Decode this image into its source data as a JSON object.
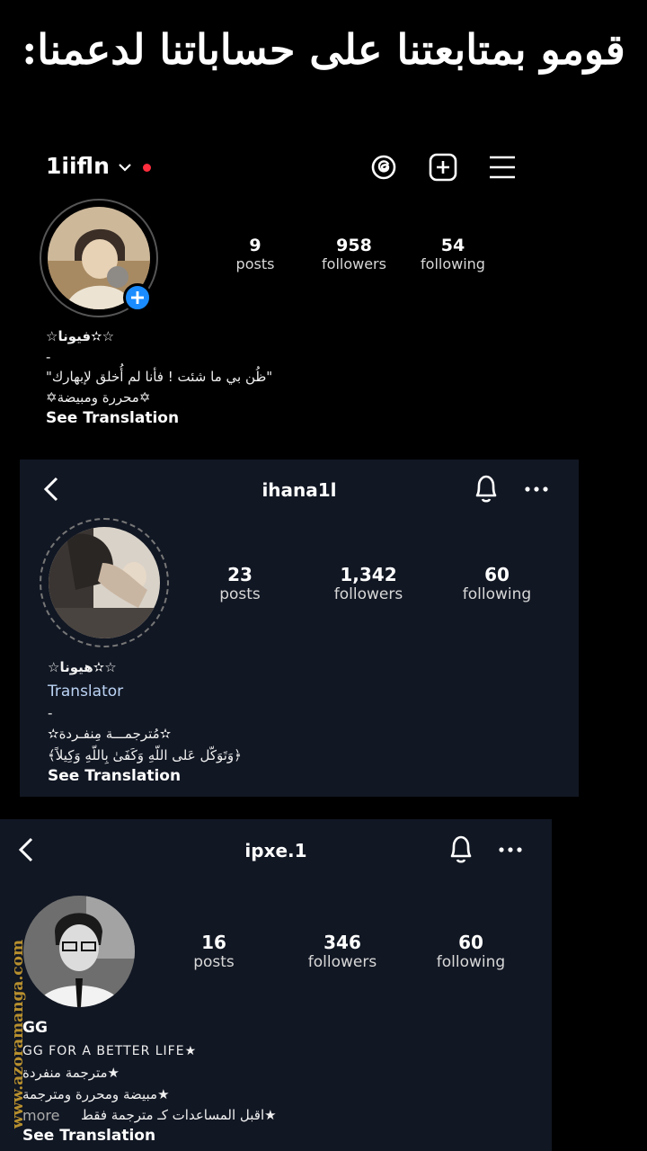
{
  "banner": {
    "text": "قومو بمتابعتنا على حساباتنا لدعمنا:"
  },
  "watermark": {
    "text": "www.azoramanga.com"
  },
  "profile1": {
    "username": "1iifln",
    "stats": [
      {
        "value": "9",
        "label": "posts"
      },
      {
        "value": "958",
        "label": "followers"
      },
      {
        "value": "54",
        "label": "following"
      }
    ],
    "name": "☆✫فيونا☆",
    "bio": [
      "-",
      "\"ظُن بي ما شئت ! فأنا لم أُخلق لإبهارك\"",
      "✡محررة ومبيضة✡"
    ],
    "see_translation": "See Translation",
    "colors": {
      "notification_dot": "#ff2d3d",
      "add_badge": "#1a8cff"
    }
  },
  "profile2": {
    "username": "ihana1l",
    "stats": [
      {
        "value": "23",
        "label": "posts"
      },
      {
        "value": "1,342",
        "label": "followers"
      },
      {
        "value": "60",
        "label": "following"
      }
    ],
    "name": "☆✫هيونا☆",
    "category": "Translator",
    "bio": [
      "-",
      "✫مُترجمـــة مِنفـردة✫",
      "﴿وَتَوَكّل عَلى اللّهِ وَكَفَىٰ بِاللّهِ وَكِيلاً﴾"
    ],
    "see_translation": "See Translation",
    "colors": {
      "category": "#bcd4f5"
    }
  },
  "profile3": {
    "username": "ipxe.1",
    "stats": [
      {
        "value": "16",
        "label": "posts"
      },
      {
        "value": "346",
        "label": "followers"
      },
      {
        "value": "60",
        "label": "following"
      }
    ],
    "name": "GG",
    "bio": [
      "GG FOR A BETTER LIFE★",
      "★مترجمة منفردة",
      "★مبيضة ومحررة ومترجمة"
    ],
    "more": "more",
    "bio_last": "★اقبل المساعدات كـ مترجمة فقط",
    "see_translation": "See Translation"
  }
}
